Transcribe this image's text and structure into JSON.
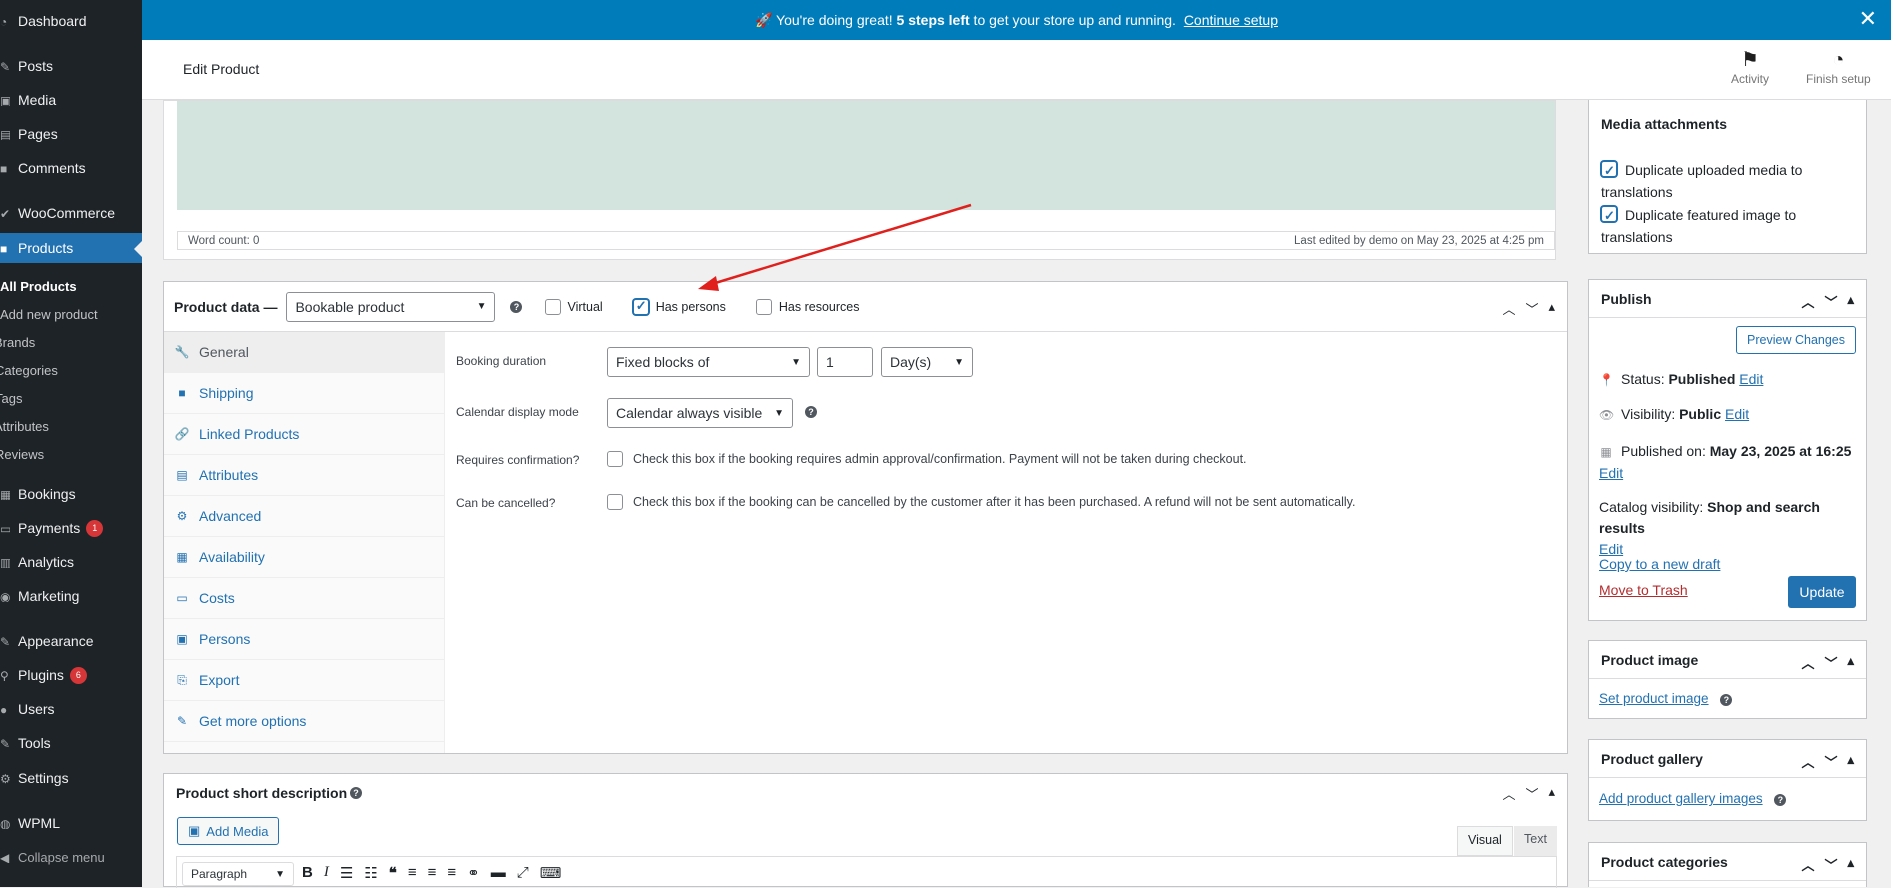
{
  "sidebar": {
    "items": [
      {
        "label": "Dashboard",
        "icon": "dashboard-icon"
      },
      {
        "label": "Posts",
        "icon": "pin-icon"
      },
      {
        "label": "Media",
        "icon": "media-icon"
      },
      {
        "label": "Pages",
        "icon": "pages-icon"
      },
      {
        "label": "Comments",
        "icon": "comments-icon"
      },
      {
        "label": "WooCommerce",
        "icon": "woocommerce-icon"
      },
      {
        "label": "Products",
        "icon": "products-icon"
      },
      {
        "label": "Bookings",
        "icon": "bookings-icon"
      },
      {
        "label": "Payments",
        "icon": "payments-icon",
        "badge": "1"
      },
      {
        "label": "Analytics",
        "icon": "analytics-icon"
      },
      {
        "label": "Marketing",
        "icon": "marketing-icon"
      },
      {
        "label": "Appearance",
        "icon": "appearance-icon"
      },
      {
        "label": "Plugins",
        "icon": "plugins-icon",
        "badge": "6"
      },
      {
        "label": "Users",
        "icon": "users-icon"
      },
      {
        "label": "Tools",
        "icon": "tools-icon"
      },
      {
        "label": "Settings",
        "icon": "settings-icon"
      },
      {
        "label": "WPML",
        "icon": "wpml-icon"
      },
      {
        "label": "Collapse menu",
        "icon": "collapse-icon"
      }
    ],
    "submenu": [
      "All Products",
      "Add new product",
      "Brands",
      "Categories",
      "Tags",
      "Attributes",
      "Reviews"
    ]
  },
  "notice": {
    "prefix": "🚀 You're doing great! ",
    "bold": "5 steps left",
    "middle": " to get your store up and running. ",
    "link": "Continue setup"
  },
  "topbar": {
    "title": "Edit Product",
    "activity": "Activity",
    "finish": "Finish setup"
  },
  "editor": {
    "word_count": "Word count: 0",
    "last_edited": "Last edited by demo on May 23, 2025 at 4:25 pm"
  },
  "product_data": {
    "label": "Product data —",
    "type": "Bookable product",
    "virtual": "Virtual",
    "has_persons": "Has persons",
    "has_resources": "Has resources",
    "tabs": [
      {
        "label": "General",
        "icon": "wrench-icon"
      },
      {
        "label": "Shipping",
        "icon": "truck-icon"
      },
      {
        "label": "Linked Products",
        "icon": "link-icon"
      },
      {
        "label": "Attributes",
        "icon": "table-icon"
      },
      {
        "label": "Advanced",
        "icon": "gear-icon"
      },
      {
        "label": "Availability",
        "icon": "calendar-icon"
      },
      {
        "label": "Costs",
        "icon": "money-icon"
      },
      {
        "label": "Persons",
        "icon": "person-icon"
      },
      {
        "label": "Export",
        "icon": "export-icon"
      },
      {
        "label": "Get more options",
        "icon": "plugin-icon"
      }
    ],
    "booking_duration_label": "Booking duration",
    "booking_duration_type": "Fixed blocks of",
    "booking_duration_value": "1",
    "booking_duration_unit": "Day(s)",
    "calendar_label": "Calendar display mode",
    "calendar_value": "Calendar always visible",
    "confirm_label": "Requires confirmation?",
    "confirm_text": "Check this box if the booking requires admin approval/confirmation. Payment will not be taken during checkout.",
    "cancel_label": "Can be cancelled?",
    "cancel_text": "Check this box if the booking can be cancelled by the customer after it has been purchased. A refund will not be sent automatically."
  },
  "short_description": {
    "title": "Product short description",
    "add_media": "Add Media",
    "visual": "Visual",
    "text": "Text",
    "format": "Paragraph"
  },
  "media_attachments": {
    "title": "Media attachments",
    "opt1": "Duplicate uploaded media to translations",
    "opt2": "Duplicate featured image to translations"
  },
  "publish": {
    "title": "Publish",
    "preview": "Preview Changes",
    "status_label": "Status: ",
    "status_value": "Published",
    "visibility_label": "Visibility: ",
    "visibility_value": "Public",
    "published_label": "Published on: ",
    "published_value": "May 23, 2025 at 16:25",
    "catalog_label": "Catalog visibility: ",
    "catalog_value": "Shop and search results",
    "edit": "Edit",
    "copy_draft": "Copy to a new draft",
    "trash": "Move to Trash",
    "update": "Update"
  },
  "product_image": {
    "title": "Product image",
    "link": "Set product image"
  },
  "product_gallery": {
    "title": "Product gallery",
    "link": "Add product gallery images"
  },
  "product_categories": {
    "title": "Product categories"
  },
  "colors": {
    "accent": "#2271b1",
    "sidebar": "#1d2327",
    "notice": "#007cba",
    "danger": "#d63638",
    "annotation_arrow": "#e0201c"
  }
}
